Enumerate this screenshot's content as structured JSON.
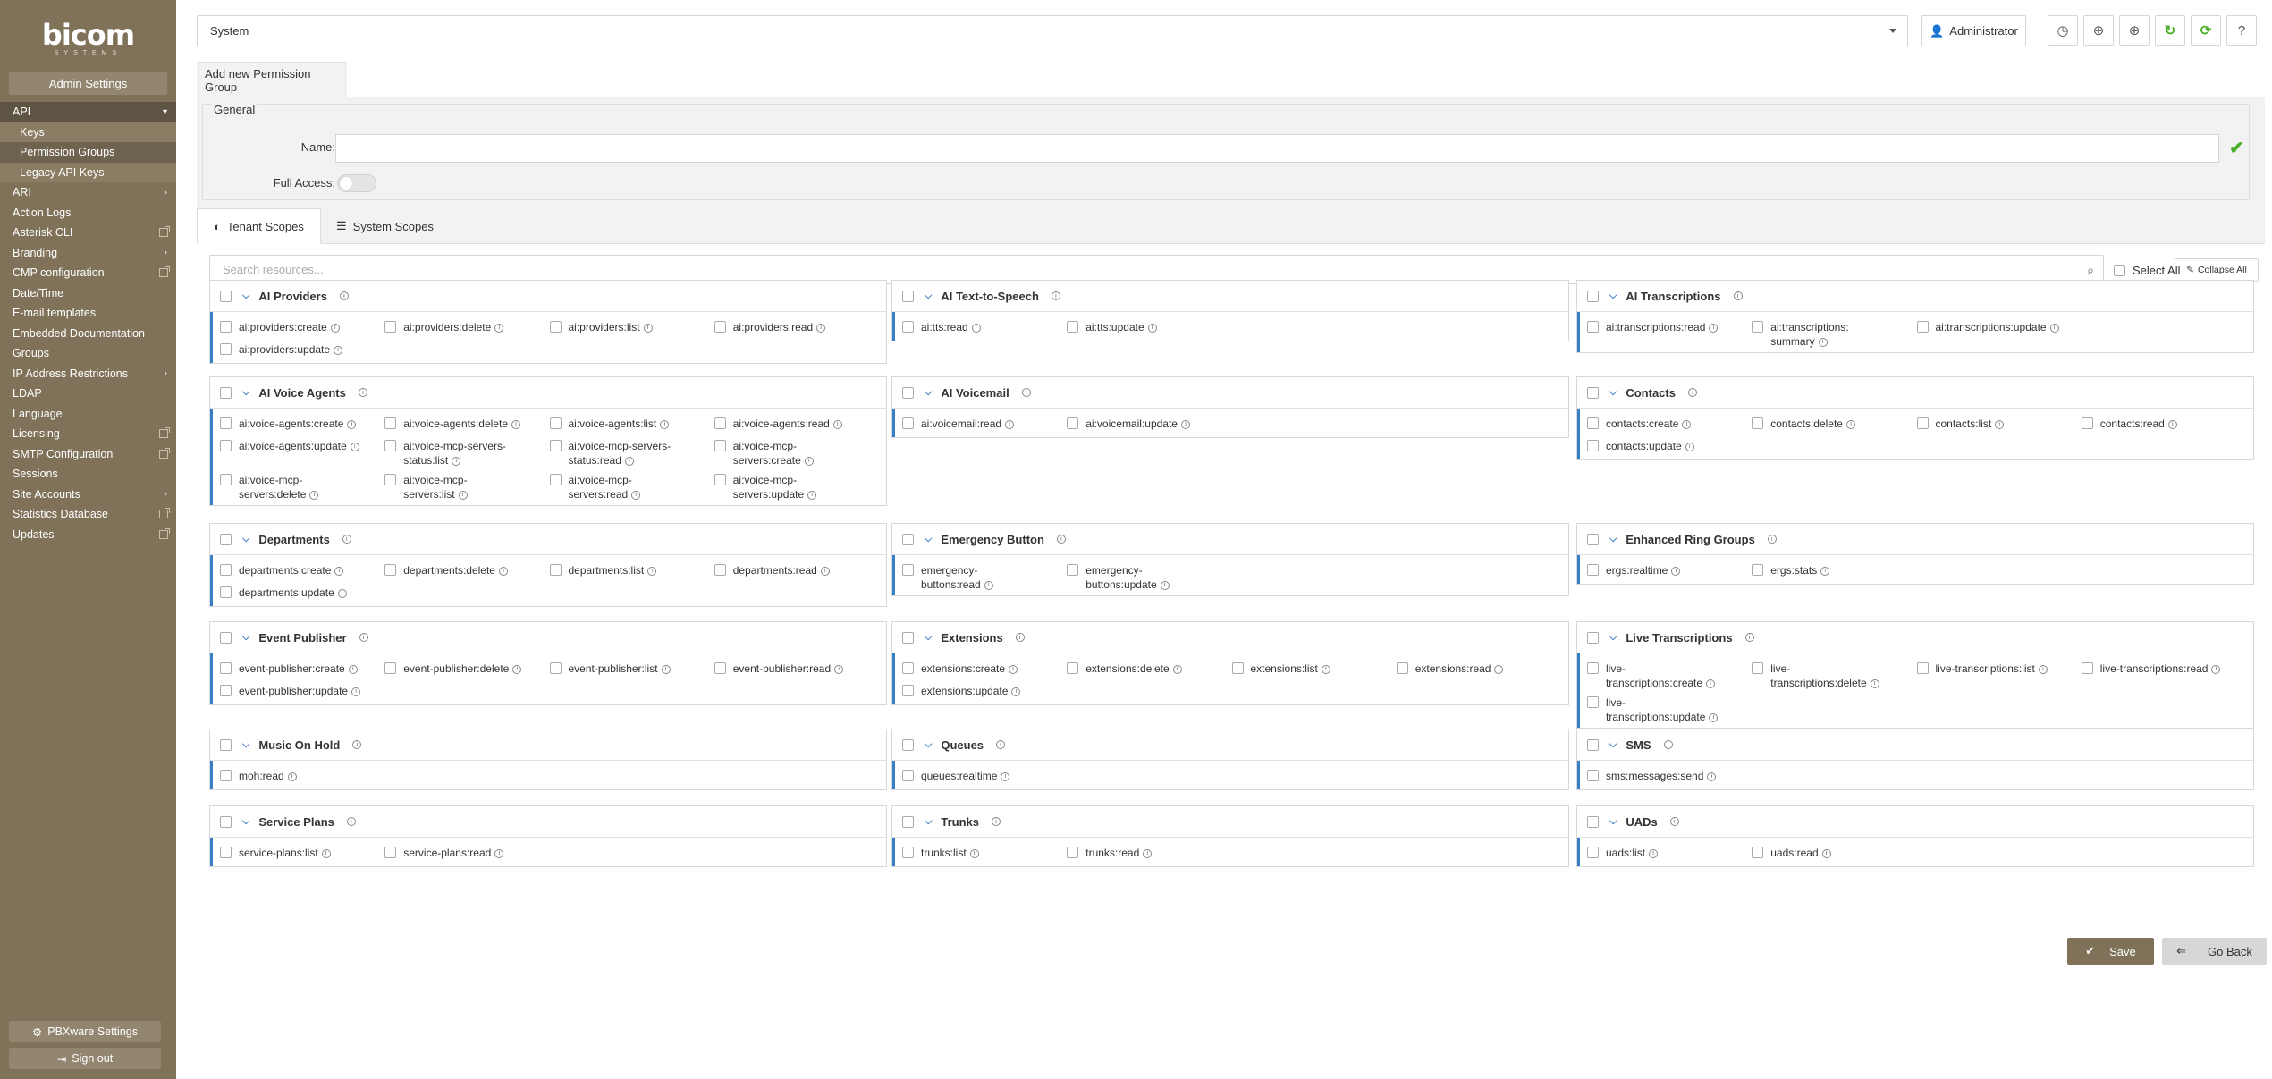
{
  "sidebar": {
    "brand": "bicom",
    "brand_sub": "SYSTEMS",
    "admin_settings": "Admin Settings",
    "items": [
      {
        "label": "API",
        "type": "active",
        "marker": "chevron-down"
      },
      {
        "label": "Keys",
        "type": "sub"
      },
      {
        "label": "Permission Groups",
        "type": "sub-current"
      },
      {
        "label": "Legacy API Keys",
        "type": "sub"
      },
      {
        "label": "ARI",
        "marker": "chevron-right"
      },
      {
        "label": "Action Logs"
      },
      {
        "label": "Asterisk CLI",
        "marker": "external"
      },
      {
        "label": "Branding",
        "marker": "chevron-right"
      },
      {
        "label": "CMP configuration",
        "marker": "external"
      },
      {
        "label": "Date/Time"
      },
      {
        "label": "E-mail templates"
      },
      {
        "label": "Embedded Documentation"
      },
      {
        "label": "Groups"
      },
      {
        "label": "IP Address Restrictions",
        "marker": "chevron-right"
      },
      {
        "label": "LDAP"
      },
      {
        "label": "Language"
      },
      {
        "label": "Licensing",
        "marker": "external"
      },
      {
        "label": "SMTP Configuration",
        "marker": "external"
      },
      {
        "label": "Sessions"
      },
      {
        "label": "Site Accounts",
        "marker": "chevron-right"
      },
      {
        "label": "Statistics Database",
        "marker": "external"
      },
      {
        "label": "Updates",
        "marker": "external"
      }
    ],
    "pbxware_settings": "PBXware Settings",
    "sign_out": "Sign out"
  },
  "topbar": {
    "system_select": "System",
    "user": "Administrator",
    "icons": [
      "clock-icon",
      "globe-icon",
      "globe-icon",
      "refresh-icon",
      "sync-icon",
      "help-icon"
    ]
  },
  "page": {
    "tab_title": "Add new Permission Group",
    "general_legend": "General",
    "name_label": "Name:",
    "name_value": "",
    "full_access_label": "Full Access:",
    "full_access": false,
    "tabs": [
      "Tenant Scopes",
      "System Scopes"
    ],
    "active_tab": "Tenant Scopes",
    "search_placeholder": "Search resources...",
    "select_all": "Select All",
    "collapse_all": "Collapse All",
    "save": "Save",
    "go_back": "Go Back"
  },
  "groups": [
    {
      "title": "AI Providers",
      "perms": [
        "ai:providers:create",
        "ai:providers:delete",
        "ai:providers:list",
        "ai:providers:read",
        "ai:providers:update"
      ]
    },
    {
      "title": "AI Text-to-Speech",
      "perms": [
        "ai:tts:read",
        "ai:tts:update"
      ]
    },
    {
      "title": "AI Transcriptions",
      "perms": [
        "ai:transcriptions:read",
        "ai:transcriptions:\nsummary",
        "ai:transcriptions:update"
      ]
    },
    {
      "title": "AI Voice Agents",
      "perms": [
        "ai:voice-agents:create",
        "ai:voice-agents:delete",
        "ai:voice-agents:list",
        "ai:voice-agents:read",
        "ai:voice-agents:update",
        "ai:voice-mcp-servers-\nstatus:list",
        "ai:voice-mcp-servers-\nstatus:read",
        "ai:voice-mcp-\nservers:create",
        "ai:voice-mcp-\nservers:delete",
        "ai:voice-mcp-\nservers:list",
        "ai:voice-mcp-\nservers:read",
        "ai:voice-mcp-\nservers:update"
      ]
    },
    {
      "title": "AI Voicemail",
      "perms": [
        "ai:voicemail:read",
        "ai:voicemail:update"
      ]
    },
    {
      "title": "Contacts",
      "perms": [
        "contacts:create",
        "contacts:delete",
        "contacts:list",
        "contacts:read",
        "contacts:update"
      ]
    },
    {
      "title": "Departments",
      "perms": [
        "departments:create",
        "departments:delete",
        "departments:list",
        "departments:read",
        "departments:update"
      ]
    },
    {
      "title": "Emergency Button",
      "perms": [
        "emergency-\nbuttons:read",
        "emergency-\nbuttons:update"
      ]
    },
    {
      "title": "Enhanced Ring Groups",
      "perms": [
        "ergs:realtime",
        "ergs:stats"
      ]
    },
    {
      "title": "Event Publisher",
      "perms": [
        "event-publisher:create",
        "event-publisher:delete",
        "event-publisher:list",
        "event-publisher:read",
        "event-publisher:update"
      ]
    },
    {
      "title": "Extensions",
      "perms": [
        "extensions:create",
        "extensions:delete",
        "extensions:list",
        "extensions:read",
        "extensions:update"
      ]
    },
    {
      "title": "Live Transcriptions",
      "perms": [
        "live-\ntranscriptions:create",
        "live-\ntranscriptions:delete",
        "live-transcriptions:list",
        "live-transcriptions:read",
        "live-\ntranscriptions:update"
      ]
    },
    {
      "title": "Music On Hold",
      "perms": [
        "moh:read"
      ]
    },
    {
      "title": "Queues",
      "perms": [
        "queues:realtime"
      ]
    },
    {
      "title": "SMS",
      "perms": [
        "sms:messages:send"
      ]
    },
    {
      "title": "Service Plans",
      "perms": [
        "service-plans:list",
        "service-plans:read"
      ]
    },
    {
      "title": "Trunks",
      "perms": [
        "trunks:list",
        "trunks:read"
      ]
    },
    {
      "title": "UADs",
      "perms": [
        "uads:list",
        "uads:read"
      ]
    }
  ]
}
